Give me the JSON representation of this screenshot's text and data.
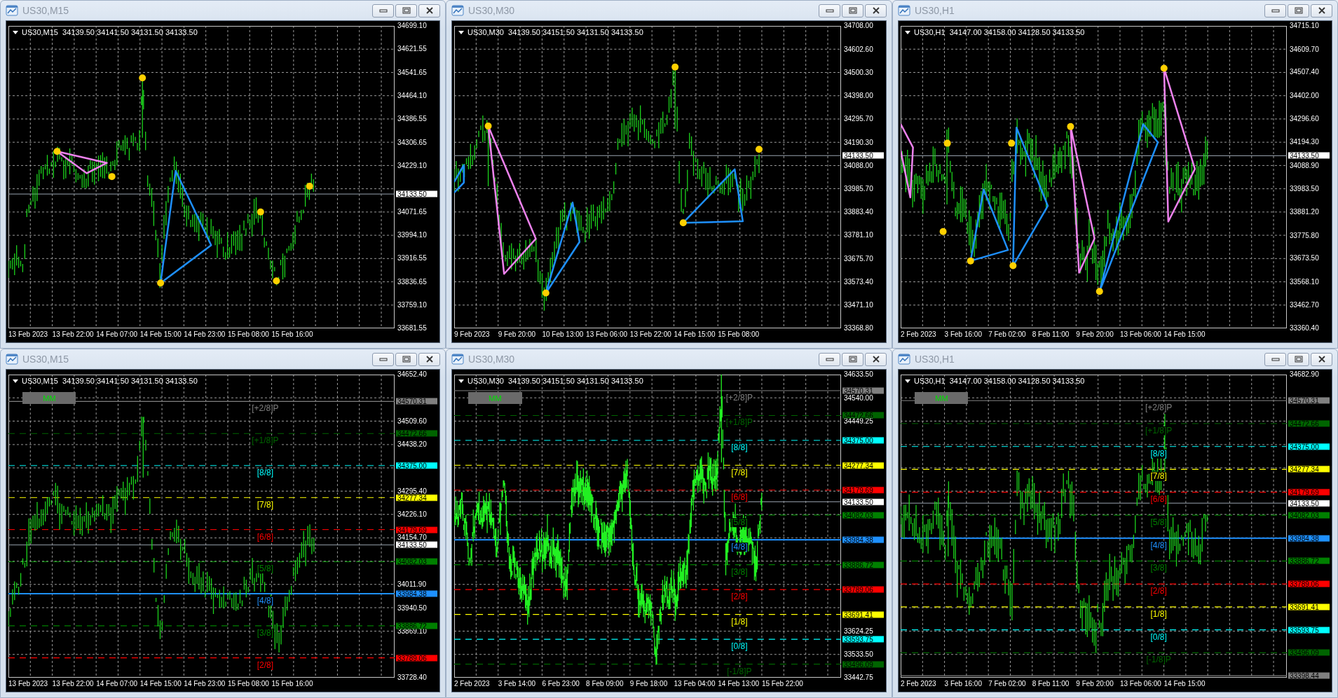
{
  "windows": [
    {
      "title": "US30,M15",
      "symbol_quote": "US30,M15  34139.50 34141.50 34131.50 34133.50",
      "current_price": "34133.50",
      "price_axis": [
        "34699.10",
        "34621.55",
        "34541.65",
        "34464.10",
        "34386.55",
        "34306.65",
        "34229.10",
        "34071.65",
        "33994.10",
        "33916.55",
        "33836.65",
        "33759.10",
        "33681.55"
      ],
      "time_axis": [
        "13 Feb 2023",
        "13 Feb 22:00",
        "14 Feb 07:00",
        "14 Feb 15:00",
        "14 Feb 23:00",
        "15 Feb 08:00",
        "15 Feb 16:00"
      ]
    },
    {
      "title": "US30,M30",
      "symbol_quote": "US30,M30  34139.50 34151.50 34131.50 34133.50",
      "current_price": "34133.50",
      "price_axis": [
        "34708.00",
        "34602.60",
        "34500.30",
        "34398.00",
        "34295.70",
        "34190.30",
        "34088.00",
        "33985.70",
        "33883.40",
        "33781.10",
        "33675.70",
        "33573.40",
        "33471.10",
        "33368.80"
      ],
      "time_axis": [
        "9 Feb 2023",
        "9 Feb 20:00",
        "10 Feb 13:00",
        "13 Feb 06:00",
        "13 Feb 22:00",
        "14 Feb 15:00",
        "15 Feb 08:00"
      ]
    },
    {
      "title": "US30,H1",
      "symbol_quote": "US30,H1  34147.00 34158.00 34128.50 34133.50",
      "current_price": "34133.50",
      "price_axis": [
        "34715.10",
        "34609.70",
        "34507.40",
        "34402.00",
        "34296.60",
        "34194.30",
        "34088.90",
        "33983.50",
        "33881.20",
        "33775.80",
        "33673.50",
        "33568.10",
        "33462.70",
        "33360.40"
      ],
      "time_axis": [
        "2 Feb 2023",
        "3 Feb 16:00",
        "7 Feb 02:00",
        "8 Feb 11:00",
        "9 Feb 20:00",
        "13 Feb 06:00",
        "14 Feb 15:00"
      ]
    },
    {
      "title": "US30,M15",
      "symbol_quote": "US30,M15  34139.50 34141.50 34131.50 34133.50",
      "current_price": "34133.50",
      "mm_button": "MM",
      "price_axis": [
        "34652.40",
        "34509.60",
        "34438.20",
        "34295.40",
        "34226.10",
        "34154.70",
        "34011.90",
        "33940.50",
        "33869.10",
        "33728.40"
      ],
      "time_axis": [
        "13 Feb 2023",
        "13 Feb 22:00",
        "14 Feb 07:00",
        "14 Feb 15:00",
        "14 Feb 23:00",
        "15 Feb 08:00",
        "15 Feb 16:00"
      ],
      "levels": [
        {
          "label": "[+2/8]P",
          "price": "34570.31",
          "color": "#808080"
        },
        {
          "label": "[+1/8]P",
          "price": "34472.66",
          "color": "#006400"
        },
        {
          "label": "[8/8]",
          "price": "34375.00",
          "color": "#00ffff"
        },
        {
          "label": "[7/8]",
          "price": "34277.34",
          "color": "#ffff00"
        },
        {
          "label": "[6/8]",
          "price": "34179.69",
          "color": "#ff0000"
        },
        {
          "label": "[5/8]",
          "price": "34082.03",
          "color": "#008000"
        },
        {
          "label": "[4/8]",
          "price": "33984.38",
          "color": "#1e90ff"
        },
        {
          "label": "[3/8]",
          "price": "33886.72",
          "color": "#008000"
        },
        {
          "label": "[2/8]",
          "price": "33789.06",
          "color": "#ff0000"
        }
      ]
    },
    {
      "title": "US30,M30",
      "symbol_quote": "US30,M30  34139.50 34151.50 34131.50 34133.50",
      "current_price": "34133.50",
      "mm_button": "MM",
      "price_axis": [
        "34633.50",
        "34540.00",
        "34449.25",
        "33624.25",
        "33533.50",
        "33442.75"
      ],
      "time_axis": [
        "2 Feb 2023",
        "3 Feb 14:00",
        "6 Feb 23:00",
        "8 Feb 09:00",
        "9 Feb 18:00",
        "13 Feb 04:00",
        "14 Feb 13:00",
        "15 Feb 22:00"
      ],
      "levels": [
        {
          "label": "[+2/8]P",
          "price": "34570.31",
          "color": "#808080"
        },
        {
          "label": "[+1/8]P",
          "price": "34472.66",
          "color": "#006400"
        },
        {
          "label": "[8/8]",
          "price": "34375.00",
          "color": "#00ffff"
        },
        {
          "label": "[7/8]",
          "price": "34277.34",
          "color": "#ffff00"
        },
        {
          "label": "[6/8]",
          "price": "34179.69",
          "color": "#ff0000"
        },
        {
          "label": "[5/8]",
          "price": "34082.03",
          "color": "#008000"
        },
        {
          "label": "[4/8]",
          "price": "33984.38",
          "color": "#1e90ff"
        },
        {
          "label": "[3/8]",
          "price": "33886.72",
          "color": "#008000"
        },
        {
          "label": "[2/8]",
          "price": "33789.06",
          "color": "#ff0000"
        },
        {
          "label": "[1/8]",
          "price": "33691.41",
          "color": "#ffff00"
        },
        {
          "label": "[0/8]",
          "price": "33593.75",
          "color": "#00ffff"
        },
        {
          "label": "[-1/8]P",
          "price": "33496.09",
          "color": "#006400"
        }
      ]
    },
    {
      "title": "US30,H1",
      "symbol_quote": "US30,H1  34147.00 34158.00 34128.50 34133.50",
      "current_price": "34133.50",
      "mm_button": "MM",
      "price_axis": [
        "34682.90"
      ],
      "time_axis": [
        "2 Feb 2023",
        "3 Feb 16:00",
        "7 Feb 02:00",
        "8 Feb 11:00",
        "9 Feb 20:00",
        "13 Feb 06:00",
        "14 Feb 15:00"
      ],
      "levels": [
        {
          "label": "[+2/8]P",
          "price": "34570.31",
          "color": "#808080"
        },
        {
          "label": "[+1/8]P",
          "price": "34472.66",
          "color": "#006400"
        },
        {
          "label": "[8/8]",
          "price": "34375.00",
          "color": "#00ffff"
        },
        {
          "label": "[7/8]",
          "price": "34277.34",
          "color": "#ffff00"
        },
        {
          "label": "[6/8]",
          "price": "34179.69",
          "color": "#ff0000"
        },
        {
          "label": "[5/8]",
          "price": "34082.03",
          "color": "#008000"
        },
        {
          "label": "[4/8]",
          "price": "33984.38",
          "color": "#1e90ff"
        },
        {
          "label": "[3/8]",
          "price": "33886.72",
          "color": "#008000"
        },
        {
          "label": "[2/8]",
          "price": "33789.06",
          "color": "#ff0000"
        },
        {
          "label": "[1/8]",
          "price": "33691.41",
          "color": "#ffff00"
        },
        {
          "label": "[0/8]",
          "price": "33593.75",
          "color": "#00ffff"
        },
        {
          "label": "[-1/8]P",
          "price": "33496.09",
          "color": "#006400"
        },
        {
          "price": "33398.44",
          "color": "#808080"
        }
      ]
    }
  ]
}
